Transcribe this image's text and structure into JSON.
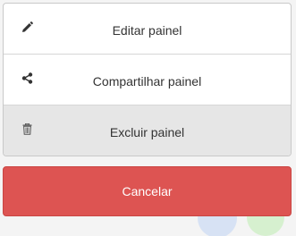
{
  "menu": {
    "items": [
      {
        "label": "Editar painel",
        "icon": "pencil-icon"
      },
      {
        "label": "Compartilhar painel",
        "icon": "share-icon"
      },
      {
        "label": "Excluir painel",
        "icon": "trash-icon",
        "highlighted": true
      }
    ]
  },
  "cancel": {
    "label": "Cancelar",
    "color": "#dd5452"
  },
  "colors": {
    "text": "#333333",
    "highlight_bg": "#e6e6e6",
    "cancel_bg": "#dd5452"
  }
}
